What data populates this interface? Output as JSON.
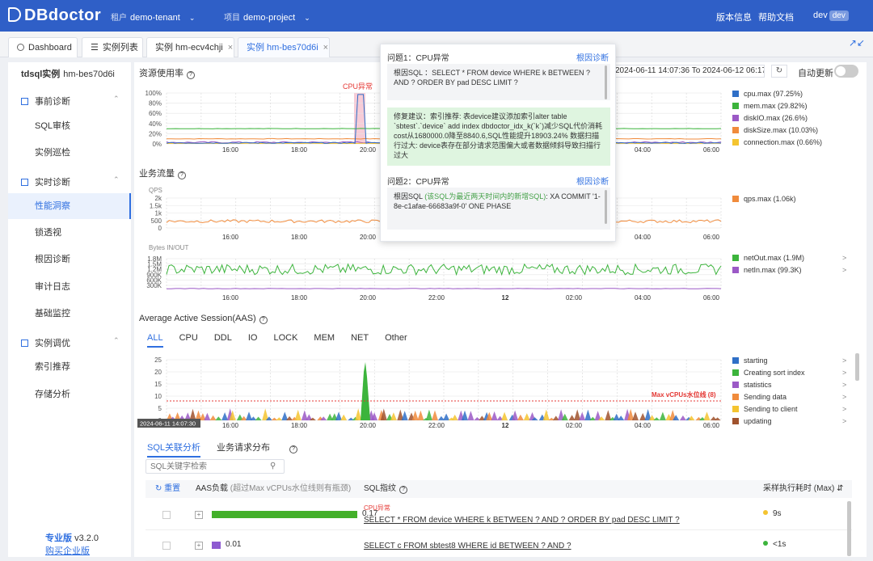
{
  "app": {
    "name": "DBdoctor"
  },
  "topbar": {
    "tenant_key": "租户",
    "tenant_val": "demo-tenant",
    "project_key": "项目",
    "project_val": "demo-project",
    "version_info": "版本信息",
    "help_docs": "帮助文档",
    "user": "dev",
    "user_badge": "dev"
  },
  "tabs": [
    {
      "label": "Dashboard"
    },
    {
      "label": "实例列表"
    },
    {
      "label": "实例 hm-ecv4chji"
    },
    {
      "label": "实例 hm-bes70d6i"
    }
  ],
  "sidebar": {
    "inst_type": "tdsql实例",
    "inst_id": "hm-bes70d6i",
    "group1": "事前诊断",
    "item_sql": "SQL审核",
    "item_patrol": "实例巡检",
    "group2": "实时诊断",
    "item_perf": "性能洞察",
    "item_lock": "锁透视",
    "item_root": "根因诊断",
    "item_audit": "审计日志",
    "item_basic": "基础监控",
    "group3": "实例调优",
    "item_index": "索引推荐",
    "item_storage": "存储分析",
    "edition": "专业版",
    "version": "v3.2.0",
    "buy": "购买企业版"
  },
  "resource": {
    "title": "资源使用率",
    "date_range": "2024-06-11 14:07:36 To 2024-06-12 06:17:47",
    "auto_refresh": "自动更新",
    "cpu_anomaly": "CPU异常",
    "y_ticks": [
      "100%",
      "80%",
      "60%",
      "40%",
      "20%",
      "0%"
    ],
    "legend": [
      {
        "label": "cpu.max (97.25%)",
        "color": "#2f6fc7"
      },
      {
        "label": "mem.max (29.82%)",
        "color": "#3cb43c"
      },
      {
        "label": "diskIO.max (26.6%)",
        "color": "#9b59c6"
      },
      {
        "label": "diskSize.max (10.03%)",
        "color": "#f08b3c"
      },
      {
        "label": "connection.max (0.66%)",
        "color": "#f4c430"
      }
    ]
  },
  "x_ticks": [
    "16:00",
    "18:00",
    "20:00",
    "22:00",
    "12",
    "02:00",
    "04:00",
    "06:00"
  ],
  "traffic": {
    "title": "业务流量",
    "qps_label": "QPS",
    "qps_ticks": [
      "2k",
      "1.5k",
      "1k",
      "500",
      "0"
    ],
    "qps_legend": [
      {
        "label": "qps.max (1.06k)",
        "color": "#f08b3c"
      }
    ],
    "bytes_label": "Bytes IN/OUT",
    "bytes_ticks": [
      "1.8M",
      "1.5M",
      "1.2M",
      "900K",
      "600K",
      "300K"
    ],
    "bytes_legend": [
      {
        "label": "netOut.max (1.9M)",
        "color": "#3cb43c"
      },
      {
        "label": "netIn.max (99.3K)",
        "color": "#9b59c6"
      }
    ]
  },
  "aas": {
    "title": "Average Active Session(AAS)",
    "tabs": [
      "ALL",
      "CPU",
      "DDL",
      "IO",
      "LOCK",
      "MEM",
      "NET",
      "Other"
    ],
    "y_ticks": [
      "25",
      "20",
      "15",
      "10",
      "5",
      "0"
    ],
    "vcpu_label": "Max vCPUs水位线 (8)",
    "cursor_time": "2024-06-11 14:07:30",
    "legend": [
      {
        "label": "starting",
        "color": "#2f6fc7"
      },
      {
        "label": "Creating sort index",
        "color": "#3cb43c"
      },
      {
        "label": "statistics",
        "color": "#9b59c6"
      },
      {
        "label": "Sending data",
        "color": "#f08b3c"
      },
      {
        "label": "Sending to client",
        "color": "#f4c430"
      },
      {
        "label": "updating",
        "color": "#a0522d"
      }
    ]
  },
  "bottom": {
    "tab1": "SQL关联分析",
    "tab2": "业务请求分布",
    "search_placeholder": "SQL关键字检索",
    "col_reset": "重置",
    "col_aas": "AAS负载",
    "col_aas_hint": "(超过Max vCPUs水位线则有瓶颈)",
    "col_sql": "SQL指纹",
    "col_time": "采样执行耗时 (Max)",
    "rows": [
      {
        "aas": "0.17",
        "bar_fraction": 0.17,
        "tag": "CPU异常",
        "sql": "SELECT * FROM device WHERE k BETWEEN ? AND ? ORDER BY pad DESC LIMIT ?",
        "time": "9s",
        "dot": "#f4c430"
      },
      {
        "aas": "0.01",
        "bar_fraction": 0.01,
        "tag": "",
        "sql": "SELECT c FROM sbtest8 WHERE id BETWEEN ? AND ?",
        "time": "<1s",
        "dot": "#3cb43c"
      }
    ]
  },
  "popup": {
    "q1_title": "问题1：CPU异常",
    "q1_link": "根因诊断",
    "q1_sql": "根因SQL ：SELECT * FROM device WHERE k BETWEEN ? AND ? ORDER BY pad DESC LIMIT ?",
    "q1_fix": "修复建议：索引推荐: 表device建议添加索引alter table `sbtest`.`device` add index dbdoctor_idx_k(`k`)减少SQL代价消耗cost从1680000.0降至8840.6,SQL性能提升18903.24% 数据扫描行过大: device表存在部分请求范围偏大或者数据倾斜导致扫描行过大",
    "q2_title": "问题2：CPU异常",
    "q2_link": "根因诊断",
    "q2_prefix": "根因SQL ",
    "q2_hint": "(该SQL为最近两天时间内的新增SQL)",
    "q2_sql": ": XA COMMIT '1-8e-c1afae-66683a9f-0' ONE PHASE"
  }
}
